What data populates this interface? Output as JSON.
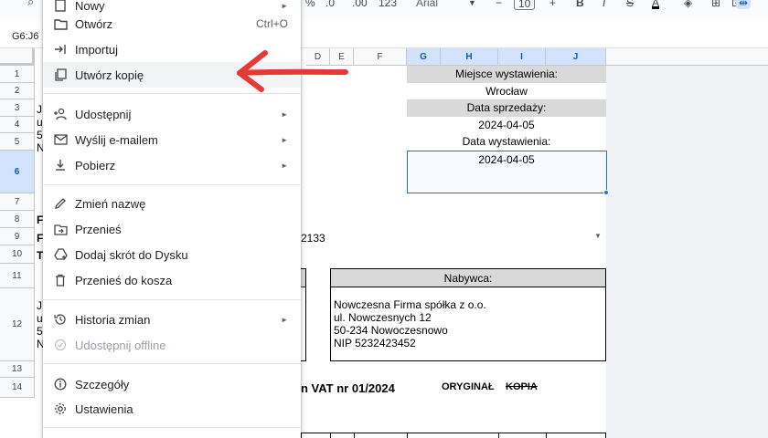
{
  "toolbar": {
    "percent": "%",
    "decimal_decrease": ".0",
    "decimal_increase": ".00",
    "format_123": "123",
    "font": "Arial",
    "font_size": "10",
    "bold": "B",
    "italic": "I",
    "strike": "S",
    "text_color": "A"
  },
  "name_box": "G6:J6",
  "columns": [
    "D",
    "E",
    "F",
    "G",
    "H",
    "I",
    "J"
  ],
  "rows": [
    "1",
    "2",
    "3",
    "4",
    "5",
    "6",
    "7",
    "8",
    "9",
    "10",
    "11",
    "12",
    "13",
    "14"
  ],
  "cells": {
    "miejsce_label": "Miejsce wystawienia:",
    "miejsce_value": "Wrocław",
    "data_sprzedazy_label": "Data sprzedaży:",
    "data_sprzedazy_value": "2024-04-05",
    "data_wystawienia_label": "Data wystawienia:",
    "data_wystawienia_value": "2024-04-05",
    "fragment_2133": "2133",
    "nabywca_label": "Nabywca:",
    "nabywca_lines": [
      "Nowczesna Firma spółka z o.o.",
      "ul. Nowczesnych 12",
      "50-234 Nowoczesnowo",
      "NIP 5232423452"
    ],
    "invoice_fragment": "n VAT nr 01/2024",
    "oryginal": "ORYGINAŁ",
    "kopia": "KOPIA",
    "left_frag": [
      "J",
      "u",
      "5",
      "N"
    ]
  },
  "menu": {
    "items": [
      {
        "label": "Nowy",
        "icon": "new-icon",
        "arrow": "►"
      },
      {
        "label": "Otwórz",
        "icon": "folder-icon",
        "shortcut": "Ctrl+O"
      },
      {
        "label": "Importuj",
        "icon": "import-icon"
      },
      {
        "label": "Utwórz kopię",
        "icon": "copy-icon"
      },
      {
        "label": "Udostępnij",
        "icon": "share-icon",
        "arrow": "►"
      },
      {
        "label": "Wyślij e-mailem",
        "icon": "email-icon",
        "arrow": "►"
      },
      {
        "label": "Pobierz",
        "icon": "download-icon",
        "arrow": "►"
      },
      {
        "label": "Zmień nazwę",
        "icon": "rename-icon"
      },
      {
        "label": "Przenieś",
        "icon": "move-icon"
      },
      {
        "label": "Dodaj skrót do Dysku",
        "icon": "drive-shortcut-icon"
      },
      {
        "label": "Przenieś do kosza",
        "icon": "trash-icon"
      },
      {
        "label": "Historia zmian",
        "icon": "history-icon",
        "arrow": "►"
      },
      {
        "label": "Udostępnij offline",
        "icon": "offline-icon"
      },
      {
        "label": "Szczegóły",
        "icon": "info-icon"
      },
      {
        "label": "Ustawienia",
        "icon": "settings-icon"
      }
    ]
  },
  "colors": {
    "accent": "#1a73e8",
    "arrow": "#e53935",
    "band": "#d9d9d9"
  }
}
